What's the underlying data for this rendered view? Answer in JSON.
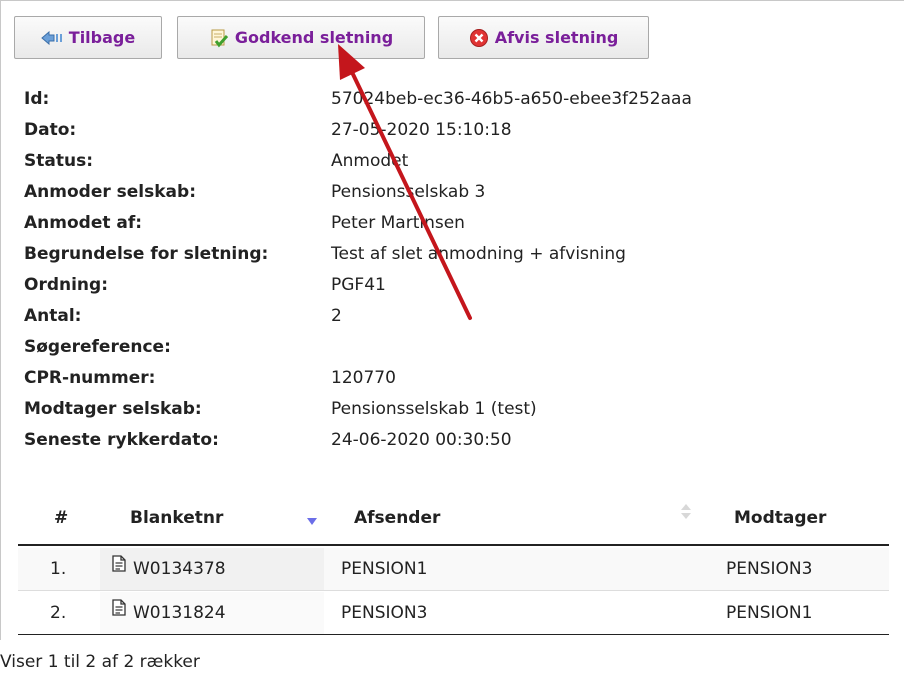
{
  "toolbar": {
    "back_label": "Tilbage",
    "approve_label": "Godkend sletning",
    "reject_label": "Afvis sletning"
  },
  "details": [
    {
      "label": "Id:",
      "value": "57024beb-ec36-46b5-a650-ebee3f252aaa"
    },
    {
      "label": "Dato:",
      "value": "27-05-2020 15:10:18"
    },
    {
      "label": "Status:",
      "value": "Anmodet"
    },
    {
      "label": "Anmoder selskab:",
      "value": "Pensionsselskab 3"
    },
    {
      "label": "Anmodet af:",
      "value": "Peter Martinsen"
    },
    {
      "label": "Begrundelse for sletning:",
      "value": "Test af slet anmodning + afvisning"
    },
    {
      "label": "Ordning:",
      "value": "PGF41"
    },
    {
      "label": "Antal:",
      "value": "2"
    },
    {
      "label": "Søgereference:",
      "value": ""
    },
    {
      "label": "CPR-nummer:",
      "value": "120770"
    },
    {
      "label": "Modtager selskab:",
      "value": "Pensionsselskab 1 (test)"
    },
    {
      "label": "Seneste rykkerdato:",
      "value": "24-06-2020 00:30:50"
    }
  ],
  "table": {
    "headers": [
      "#",
      "Blanketnr",
      "Afsender",
      "Modtager"
    ],
    "rows": [
      {
        "num": "1.",
        "blanketnr": "W0134378",
        "afsender": "PENSION1",
        "modtager": "PENSION3"
      },
      {
        "num": "2.",
        "blanketnr": "W0131824",
        "afsender": "PENSION3",
        "modtager": "PENSION1"
      }
    ]
  },
  "footer": {
    "info": "Viser 1 til 2 af 2 rækker"
  },
  "icons": {
    "back": "back-arrow-icon",
    "approve": "approve-document-icon",
    "reject": "reject-circle-icon",
    "document": "document-icon"
  },
  "colors": {
    "button_text": "#7a1f9a",
    "annotation_arrow": "#c4161c",
    "sort_indicator": "#6b6ee8"
  }
}
